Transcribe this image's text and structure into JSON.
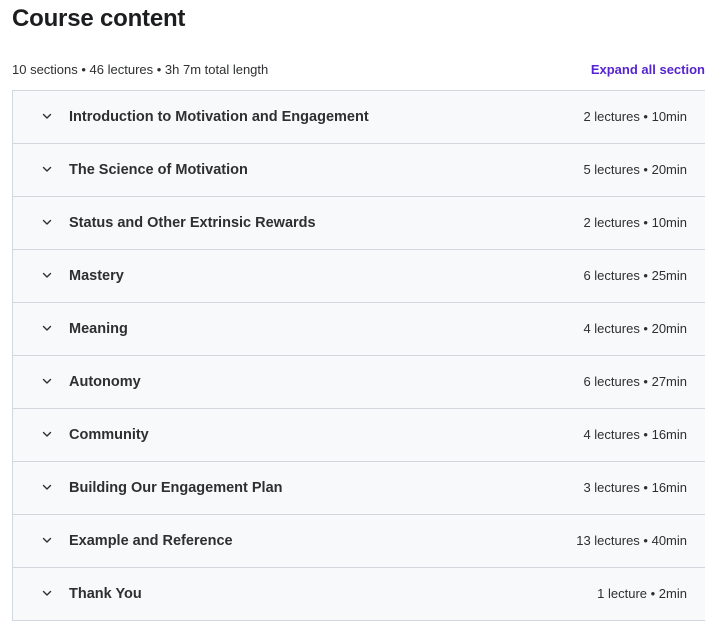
{
  "header": {
    "title": "Course content"
  },
  "summary": {
    "text": "10 sections • 46 lectures • 3h 7m total length",
    "expand_label": "Expand all section"
  },
  "colors": {
    "accent": "#5624d0",
    "row_background": "#f7f9fa",
    "border": "#d1d7dc",
    "text": "#2d2f31"
  },
  "sections": [
    {
      "title": "Introduction to Motivation and Engagement",
      "info": "2 lectures • 10min"
    },
    {
      "title": "The Science of Motivation",
      "info": "5 lectures • 20min"
    },
    {
      "title": "Status and Other Extrinsic Rewards",
      "info": "2 lectures • 10min"
    },
    {
      "title": "Mastery",
      "info": "6 lectures • 25min"
    },
    {
      "title": "Meaning",
      "info": "4 lectures • 20min"
    },
    {
      "title": "Autonomy",
      "info": "6 lectures • 27min"
    },
    {
      "title": "Community",
      "info": "4 lectures • 16min"
    },
    {
      "title": "Building Our Engagement Plan",
      "info": "3 lectures • 16min"
    },
    {
      "title": "Example and Reference",
      "info": "13 lectures • 40min"
    },
    {
      "title": "Thank You",
      "info": "1 lecture • 2min"
    }
  ]
}
